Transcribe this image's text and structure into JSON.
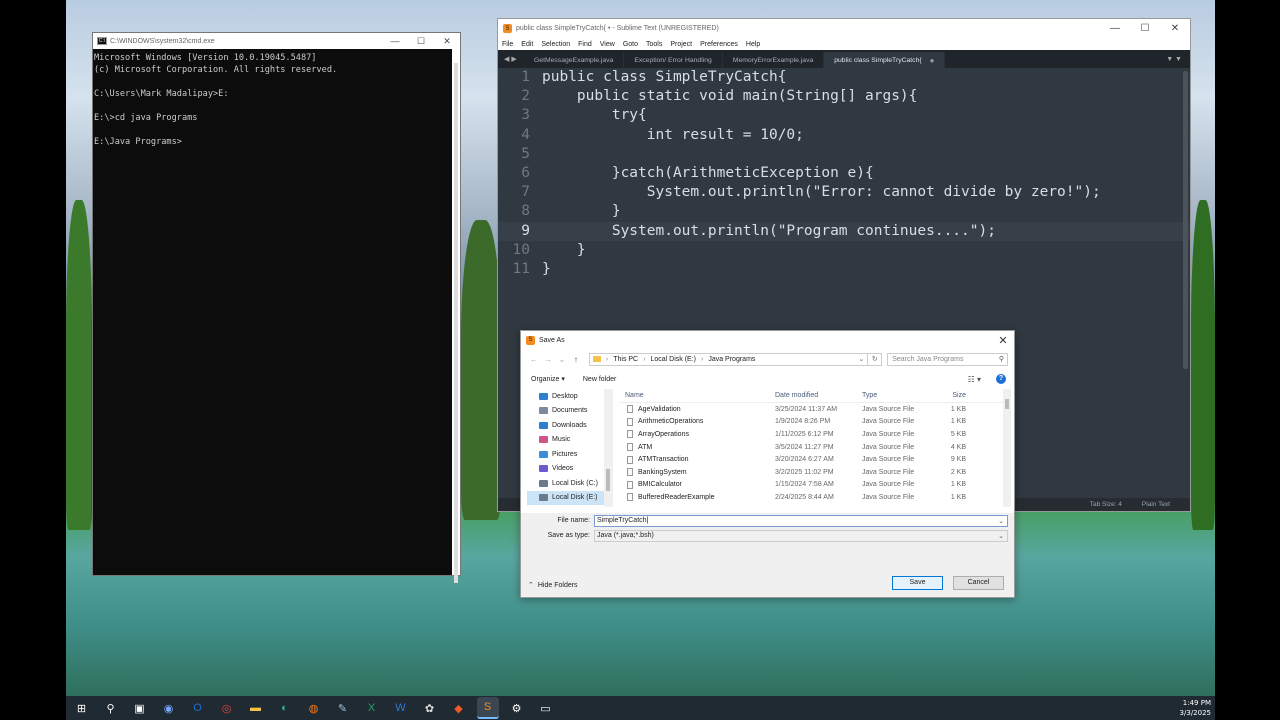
{
  "cmd": {
    "title": "C:\\WINDOWS\\system32\\cmd.exe",
    "lines": [
      "Microsoft Windows [Version 10.0.19045.5487]",
      "(c) Microsoft Corporation. All rights reserved.",
      "",
      "C:\\Users\\Mark Madalipay>E:",
      "",
      "E:\\>cd java Programs",
      "",
      "E:\\Java Programs>"
    ]
  },
  "sublime": {
    "title": "public class SimpleTryCatch{ • - Sublime Text (UNREGISTERED)",
    "menu": [
      "File",
      "Edit",
      "Selection",
      "Find",
      "View",
      "Goto",
      "Tools",
      "Project",
      "Preferences",
      "Help"
    ],
    "tabs": [
      "GetMessageExample.java",
      "Exception/ Error Handling",
      "MemoryErrorExample.java",
      "public class SimpleTryCatch{"
    ],
    "active_tab": 3,
    "current_line": 9,
    "code": [
      "public class SimpleTryCatch{",
      "    public static void main(String[] args){",
      "        try{",
      "            int result = 10/0;",
      "",
      "        }catch(ArithmeticException e){",
      "            System.out.println(\"Error: cannot divide by zero!\");",
      "        }",
      "        System.out.println(\"Program continues....\");",
      "    }",
      "}"
    ],
    "status": {
      "tab_size": "Tab Size: 4",
      "syntax": "Plain Text"
    }
  },
  "save_dialog": {
    "title": "Save As",
    "breadcrumb": [
      "This PC",
      "Local Disk (E:)",
      "Java Programs"
    ],
    "search_placeholder": "Search Java Programs",
    "organize": "Organize ▾",
    "new_folder": "New folder",
    "nav_items": [
      {
        "label": "Desktop",
        "color": "#2f7fd1"
      },
      {
        "label": "Documents",
        "color": "#7b8a9c"
      },
      {
        "label": "Downloads",
        "color": "#2f7fd1"
      },
      {
        "label": "Music",
        "color": "#d0548a"
      },
      {
        "label": "Pictures",
        "color": "#3b8fd9"
      },
      {
        "label": "Videos",
        "color": "#6a5bd0"
      },
      {
        "label": "Local Disk (C:)",
        "color": "#6b7b8b"
      },
      {
        "label": "Local Disk (E:)",
        "color": "#6b7b8b"
      }
    ],
    "selected_nav": 7,
    "columns": {
      "name": "Name",
      "date": "Date modified",
      "type": "Type",
      "size": "Size"
    },
    "files": [
      {
        "name": "AgeValidation",
        "date": "3/25/2024 11:37 AM",
        "type": "Java Source File",
        "size": "1 KB"
      },
      {
        "name": "ArithmeticOperations",
        "date": "1/9/2024 8:26 PM",
        "type": "Java Source File",
        "size": "1 KB"
      },
      {
        "name": "ArrayOperations",
        "date": "1/11/2025 6:12 PM",
        "type": "Java Source File",
        "size": "5 KB"
      },
      {
        "name": "ATM",
        "date": "3/5/2024 11:27 PM",
        "type": "Java Source File",
        "size": "4 KB"
      },
      {
        "name": "ATMTransaction",
        "date": "3/20/2024 6:27 AM",
        "type": "Java Source File",
        "size": "9 KB"
      },
      {
        "name": "BankingSystem",
        "date": "3/2/2025 11:02 PM",
        "type": "Java Source File",
        "size": "2 KB"
      },
      {
        "name": "BMICalculator",
        "date": "1/15/2024 7:58 AM",
        "type": "Java Source File",
        "size": "1 KB"
      },
      {
        "name": "BufferedReaderExample",
        "date": "2/24/2025 8:44 AM",
        "type": "Java Source File",
        "size": "1 KB"
      }
    ],
    "file_name_label": "File name:",
    "file_name_value": "SimpleTryCatch",
    "save_type_label": "Save as type:",
    "save_type_value": "Java (*.java;*.bsh)",
    "hide_folders": "Hide Folders",
    "save_btn": "Save",
    "cancel_btn": "Cancel"
  },
  "taskbar": {
    "time": "1:49 PM",
    "date": "3/3/2025",
    "apps": [
      {
        "name": "start",
        "glyph": "⊞",
        "color": "#ffffff"
      },
      {
        "name": "search",
        "glyph": "⚲",
        "color": "#ffffff"
      },
      {
        "name": "task-view",
        "glyph": "▣",
        "color": "#ffffff"
      },
      {
        "name": "copilot",
        "glyph": "◉",
        "color": "#7aa8ff"
      },
      {
        "name": "outlook",
        "glyph": "O",
        "color": "#1b6fd1"
      },
      {
        "name": "chrome",
        "glyph": "◎",
        "color": "#e8453c"
      },
      {
        "name": "file-explorer",
        "glyph": "▬",
        "color": "#f2c54a"
      },
      {
        "name": "edge",
        "glyph": "◐",
        "color": "#2fb4a7"
      },
      {
        "name": "firefox",
        "glyph": "◍",
        "color": "#ff7a1a"
      },
      {
        "name": "notepad",
        "glyph": "✎",
        "color": "#9fc4e8"
      },
      {
        "name": "excel",
        "glyph": "X",
        "color": "#21a366"
      },
      {
        "name": "word",
        "glyph": "W",
        "color": "#2b7cd3"
      },
      {
        "name": "paint",
        "glyph": "✿",
        "color": "#dcdcdc"
      },
      {
        "name": "brave",
        "glyph": "◆",
        "color": "#f05a2a"
      },
      {
        "name": "sublime-text",
        "glyph": "S",
        "color": "#f58b1f"
      },
      {
        "name": "settings",
        "glyph": "⚙",
        "color": "#ffffff"
      },
      {
        "name": "terminal",
        "glyph": "▭",
        "color": "#ffffff"
      }
    ],
    "active_app": 14
  }
}
